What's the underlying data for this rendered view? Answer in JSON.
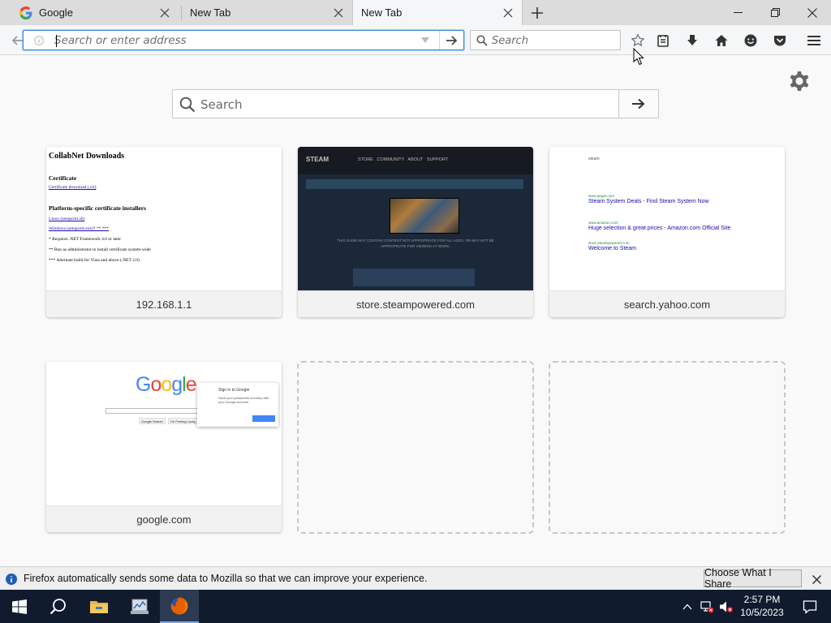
{
  "tabs": [
    {
      "title": "Google",
      "favicon": "google-g-icon",
      "active": false
    },
    {
      "title": "New Tab",
      "active": false
    },
    {
      "title": "New Tab",
      "active": true
    }
  ],
  "urlbar": {
    "placeholder": "Search or enter address",
    "value": ""
  },
  "searchbar": {
    "placeholder": "Search"
  },
  "newtab_search": {
    "placeholder": "Search"
  },
  "tiles": [
    {
      "label": "192.168.1.1"
    },
    {
      "label": "store.steampowered.com"
    },
    {
      "label": "search.yahoo.com"
    },
    {
      "label": "google.com"
    }
  ],
  "thumb_collabnet": {
    "heading": "CollabNet Downloads",
    "cert_heading": "Certificate",
    "cert_link": "Certificate download (.crt)",
    "platform_heading": "Platform-specific certificate installers",
    "linux_link": "Linux (setupcert.sh)",
    "windows_link": "Windows (setupcert.exe)* ** ***",
    "note1": "* Requires .NET Framework 4.0 or later",
    "note2": "** Run as administrator to install certificate system-wide",
    "note3": "*** Alternate build for Vista and above (.NET 2.0)"
  },
  "thumb_steam": {
    "logo": "STEAM",
    "nav": "STORE COMMUNITY ABOUT SUPPORT",
    "warning": "THIS GAME MAY CONTAIN CONTENT NOT APPROPRIATE FOR ALL AGES, OR MAY NOT BE APPROPRIATE FOR VIEWING AT WORK."
  },
  "thumb_yahoo": {
    "query": "steam",
    "result1": "Steam System Deals - Find Steam System Now",
    "result2": "Huge selection & great prices - Amazon.com Official Site",
    "result3": "Welcome to Steam",
    "url1": "www.target.com",
    "url2": "www.amazon.com",
    "url3": "store.steampowered.com"
  },
  "thumb_google": {
    "logo": "Google",
    "btn1": "Google Search",
    "btn2": "I'm Feeling Lucky",
    "popup_title": "Sign in to Google",
    "popup_text": "Save your passwords securely with your Google Account"
  },
  "notification": {
    "text": "Firefox automatically sends some data to Mozilla so that we can improve your experience.",
    "button": "Choose What I Share"
  },
  "clock": {
    "time": "2:57 PM",
    "date": "10/5/2023"
  },
  "colors": {
    "accent": "#3b86d6",
    "taskbar": "#101b2e",
    "firefox_orange": "#e66000"
  }
}
